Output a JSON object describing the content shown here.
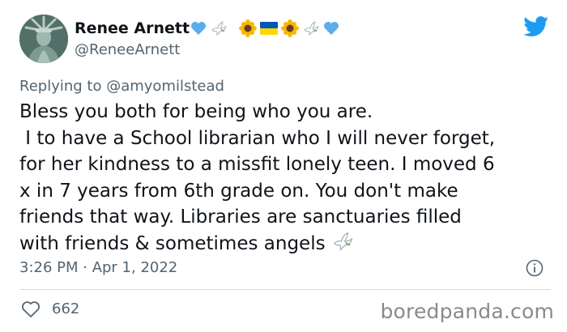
{
  "tweet": {
    "display_name": "Renee Arnett",
    "name_emojis": [
      "blue-heart-icon",
      "dove-icon",
      "sunflower-icon",
      "ukraine-flag-icon",
      "sunflower-icon",
      "dove-icon",
      "blue-heart-icon"
    ],
    "handle": "@ReneeArnett",
    "reply_prefix": "Replying to",
    "reply_to": "@amyomilstead",
    "text_lines": [
      "Bless you both for being who you are.",
      " I to have a School librarian who I will never forget,",
      "for her kindness to a missfit lonely teen. I moved 6",
      "x in 7 years from 6th grade on. You don't make",
      "friends that way. Libraries are sanctuaries filled",
      "with friends & sometimes angels"
    ],
    "timestamp": "3:26 PM · Apr 1, 2022",
    "like_count": "662"
  },
  "watermark": "boredpanda.com",
  "colors": {
    "twitter_blue": "#1d9bf0",
    "secondary_text": "#536471",
    "primary_text": "#0f1419",
    "divider": "#cfd9de",
    "flag_blue": "#0057b7",
    "flag_yellow": "#ffd700"
  }
}
